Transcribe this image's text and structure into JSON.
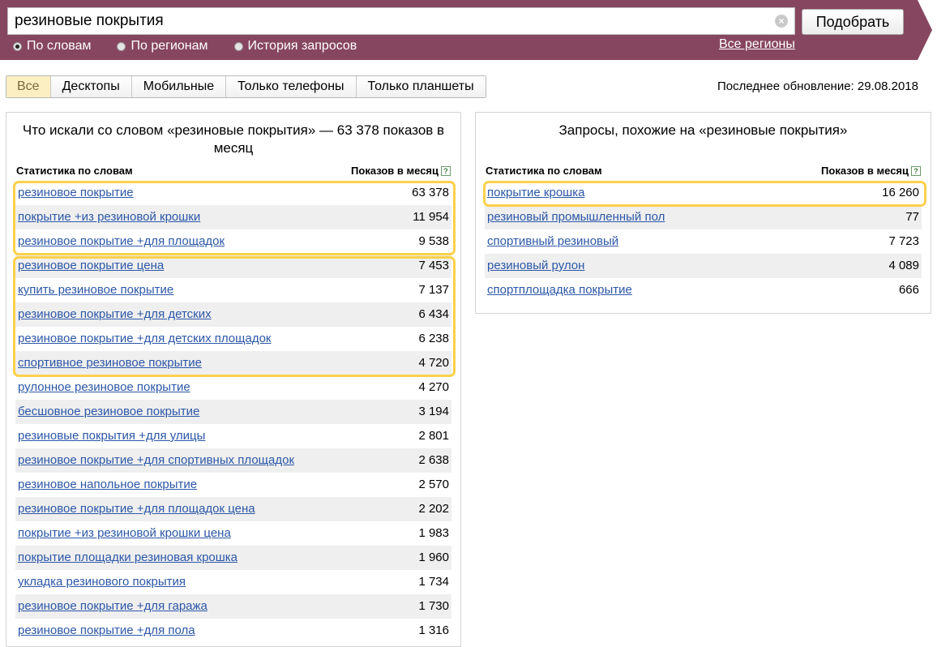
{
  "search": {
    "value": "резиновые покрытия",
    "submit_label": "Подобрать"
  },
  "modes": [
    {
      "label": "По словам",
      "selected": true
    },
    {
      "label": "По регионам",
      "selected": false
    },
    {
      "label": "История запросов",
      "selected": false
    }
  ],
  "regions_link": "Все регионы",
  "device_tabs": [
    {
      "label": "Все",
      "active": true
    },
    {
      "label": "Десктопы",
      "active": false
    },
    {
      "label": "Мобильные",
      "active": false
    },
    {
      "label": "Только телефоны",
      "active": false
    },
    {
      "label": "Только планшеты",
      "active": false
    }
  ],
  "last_update": "Последнее обновление: 29.08.2018",
  "colors": {
    "header_band": "#87465f",
    "link": "#2c57a8",
    "highlight": "#fcd14b",
    "active_tab": "#fcf0c2"
  },
  "left_panel": {
    "title": "Что искали со словом «резиновые покрытия» — 63 378 показов в месяц",
    "col_keyword": "Статистика по словам",
    "col_count": "Показов в месяц",
    "help_icon_text": "?",
    "rows": [
      {
        "keyword": "резиновое покрытие",
        "count": "63 378"
      },
      {
        "keyword": "покрытие +из резиновой крошки",
        "count": "11 954"
      },
      {
        "keyword": "резиновое покрытие +для площадок",
        "count": "9 538"
      },
      {
        "keyword": "резиновое покрытие цена",
        "count": "7 453"
      },
      {
        "keyword": "купить резиновое покрытие",
        "count": "7 137"
      },
      {
        "keyword": "резиновое покрытие +для детских",
        "count": "6 434"
      },
      {
        "keyword": "резиновое покрытие +для детских площадок",
        "count": "6 238"
      },
      {
        "keyword": "спортивное резиновое покрытие",
        "count": "4 720"
      },
      {
        "keyword": "рулонное резиновое покрытие",
        "count": "4 270"
      },
      {
        "keyword": "бесшовное резиновое покрытие",
        "count": "3 194"
      },
      {
        "keyword": "резиновые покрытия +для улицы",
        "count": "2 801"
      },
      {
        "keyword": "резиновое покрытие +для спортивных площадок",
        "count": "2 638"
      },
      {
        "keyword": "резиновое напольное покрытие",
        "count": "2 570"
      },
      {
        "keyword": "резиновое покрытие +для площадок цена",
        "count": "2 202"
      },
      {
        "keyword": "покрытие +из резиновой крошки цена",
        "count": "1 983"
      },
      {
        "keyword": "покрытие площадки резиновая крошка",
        "count": "1 960"
      },
      {
        "keyword": "укладка резинового покрытия",
        "count": "1 734"
      },
      {
        "keyword": "резиновое покрытие +для гаража",
        "count": "1 730"
      },
      {
        "keyword": "резиновое покрытие +для пола",
        "count": "1 316"
      }
    ]
  },
  "right_panel": {
    "title": "Запросы, похожие на «резиновые покрытия»",
    "col_keyword": "Статистика по словам",
    "col_count": "Показов в месяц",
    "help_icon_text": "?",
    "rows": [
      {
        "keyword": "покрытие крошка",
        "count": "16 260"
      },
      {
        "keyword": "резиновый промышленный пол",
        "count": "77"
      },
      {
        "keyword": "спортивный резиновый",
        "count": "7 723"
      },
      {
        "keyword": "резиновый рулон",
        "count": "4 089"
      },
      {
        "keyword": "спортплощадка покрытие",
        "count": "666"
      }
    ]
  }
}
